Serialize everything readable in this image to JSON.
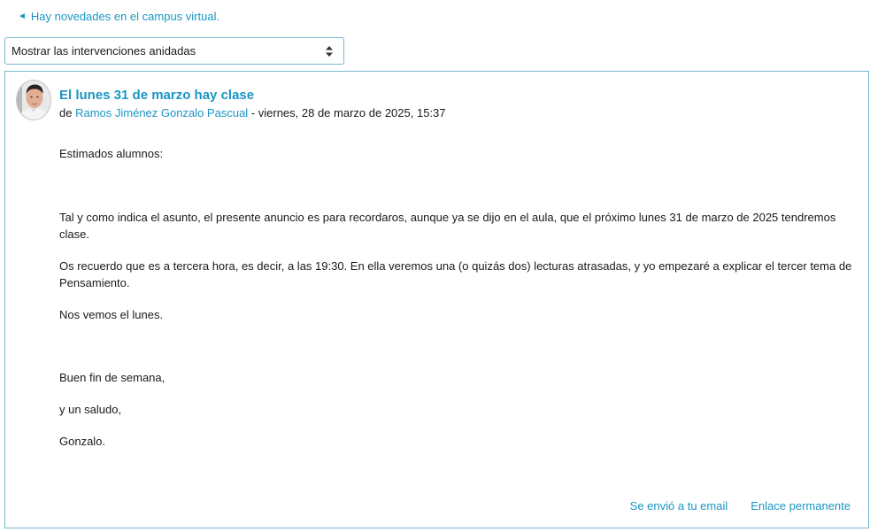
{
  "nav": {
    "back_label": "Hay novedades en el campus virtual."
  },
  "display_mode": {
    "selected": "Mostrar las intervenciones anidadas"
  },
  "post": {
    "title": "El lunes 31 de marzo hay clase",
    "by_prefix": "de",
    "author": "Ramos Jiménez Gonzalo Pascual",
    "date_text": " - viernes, 28 de marzo de 2025, 15:37",
    "body": {
      "p1": "Estimados alumnos:",
      "p2": "Tal y como indica el asunto, el presente anuncio es para recordaros, aunque ya se dijo en el aula, que el próximo lunes 31 de marzo de 2025 tendremos clase.",
      "p3": "Os recuerdo que es a tercera hora, es decir, a las 19:30. En ella veremos una (o quizás dos) lecturas atrasadas, y yo empezaré a explicar el tercer tema de Pensamiento.",
      "p4": "Nos vemos el lunes.",
      "p5": "Buen fin de semana,",
      "p6": "y un saludo,",
      "p7": "Gonzalo."
    },
    "footer": {
      "email_label": "Se envió a tu email",
      "permalink_label": "Enlace permanente"
    }
  },
  "colors": {
    "link": "#1a96c4",
    "border": "#79b8d0",
    "text": "#1a1a1a"
  },
  "icons": {
    "back": "left-triangle-icon",
    "select": "updown-arrows-icon",
    "avatar": "user-photo"
  }
}
